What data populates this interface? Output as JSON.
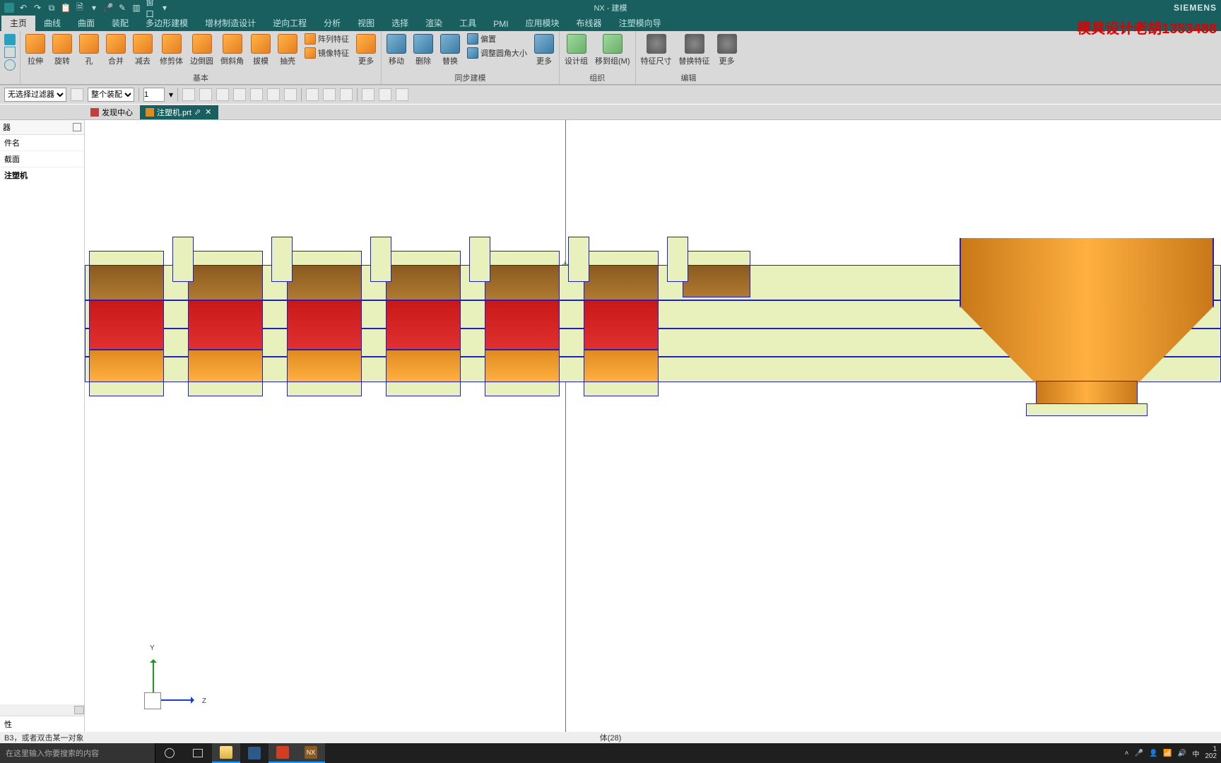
{
  "titlebar": {
    "app_title": "NX - 建模",
    "brand": "SIEMENS",
    "qat_menu": "窗口",
    "watermark": "模具设计老胡1353488"
  },
  "tabs": [
    "主页",
    "曲线",
    "曲面",
    "装配",
    "多边形建模",
    "增材制造设计",
    "逆向工程",
    "分析",
    "视图",
    "选择",
    "渲染",
    "工具",
    "PMI",
    "应用模块",
    "布线器",
    "注塑模向导"
  ],
  "ribbon": {
    "sketch": {
      "label": ""
    },
    "group_basic": {
      "extrude": "拉伸",
      "revolve": "旋转",
      "hole": "孔",
      "unite": "合并",
      "subtract": "减去",
      "trim": "修剪体",
      "edge_blend": "边倒圆",
      "chamfer": "倒斜角",
      "draft": "拔模",
      "shell": "抽壳",
      "pattern": "阵列特征",
      "mirror": "镜像特征",
      "more": "更多",
      "title": "基本"
    },
    "group_sync": {
      "move": "移动",
      "delete": "删除",
      "replace": "替换",
      "offset": "偏置",
      "resize": "调整圆角大小",
      "more": "更多",
      "title": "同步建模"
    },
    "group_org": {
      "design_group": "设计组",
      "move_to_group": "移到组(M)",
      "title": "组织"
    },
    "group_edit": {
      "feature_dim": "特征尺寸",
      "replace_feature": "替换特征",
      "more": "更多",
      "title": "编辑"
    }
  },
  "optbar": {
    "filter": "无选择过滤器",
    "scope": "整个装配",
    "qty": "1"
  },
  "filetabs": {
    "discover": "发现中心",
    "part": "注塑机.prt"
  },
  "panel": {
    "header": "器",
    "col_name": "件名",
    "section": "截面",
    "item": "注塑机",
    "footer": "性"
  },
  "triad": {
    "y": "Y",
    "z": "Z"
  },
  "status": {
    "left": "B3，或者双击某一对象",
    "mid": "体(28)"
  },
  "taskbar": {
    "search_placeholder": "在这里输入你要搜索的内容",
    "nx": "NX",
    "ime": "中",
    "time": "1",
    "date": "202"
  }
}
